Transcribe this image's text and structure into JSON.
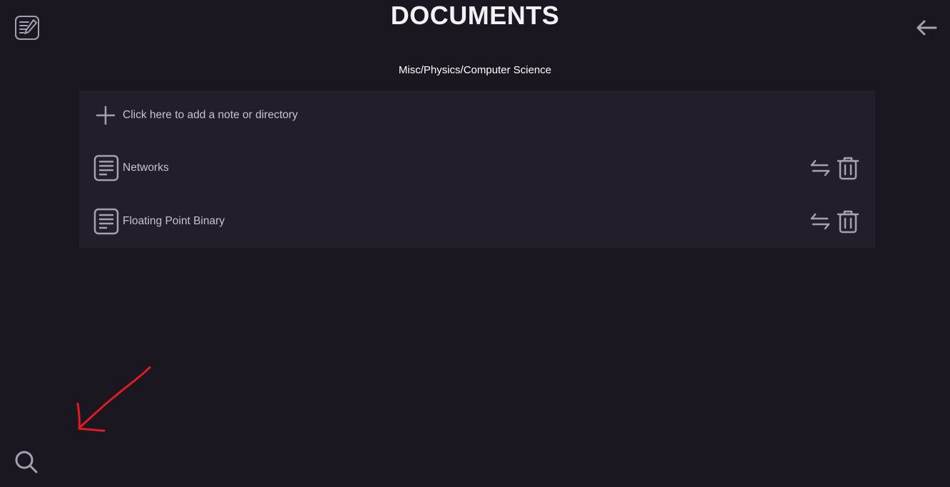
{
  "header": {
    "title": "DOCUMENTS",
    "path": "Misc/Physics/Computer Science"
  },
  "actions": {
    "add_label": "Click here to add a note or directory"
  },
  "items": [
    {
      "label": "Networks",
      "type": "note"
    },
    {
      "label": "Floating Point Binary",
      "type": "note"
    }
  ],
  "icons": {
    "logo": "notes-logo-icon",
    "back": "back-arrow-icon",
    "add": "plus-icon",
    "note": "document-icon",
    "move": "swap-arrows-icon",
    "delete": "trash-icon",
    "search": "search-icon"
  },
  "colors": {
    "background": "#1b1720",
    "panel": "#221e2a",
    "icon": "#a8a1ad",
    "text": "#c8c2cc",
    "annotation": "#e01b24"
  }
}
